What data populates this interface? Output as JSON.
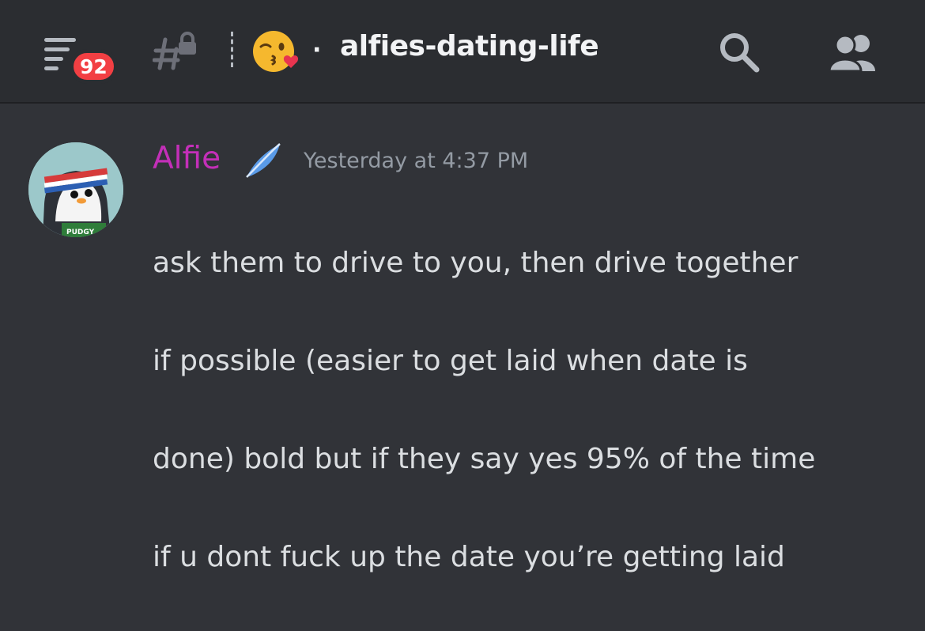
{
  "header": {
    "menu_icon": "hamburger-menu-icon",
    "unread_badge": "92",
    "channel_type_icon": "locked-text-channel-icon",
    "channel_emoji": "kissing-face-with-heart-emoji",
    "separator": "·",
    "channel_name": "alfies-dating-life",
    "search_icon": "search-icon",
    "members_icon": "members-icon"
  },
  "message": {
    "author": "Alfie",
    "author_color": "#c32fb8",
    "author_badge_icon": "feather-icon",
    "timestamp": "Yesterday at 4:37 PM",
    "avatar_text": "PUDGY",
    "lines": [
      "ask them to drive to you, then drive together",
      "if possible (easier to get laid when date is",
      "done) bold but if they say yes 95% of the time",
      "if u dont fuck up the date you’re getting laid"
    ]
  },
  "colors": {
    "background": "#313338",
    "header_background": "#2b2d31",
    "badge": "#f23f43",
    "text": "#dbdee1",
    "muted": "#949ba4"
  }
}
